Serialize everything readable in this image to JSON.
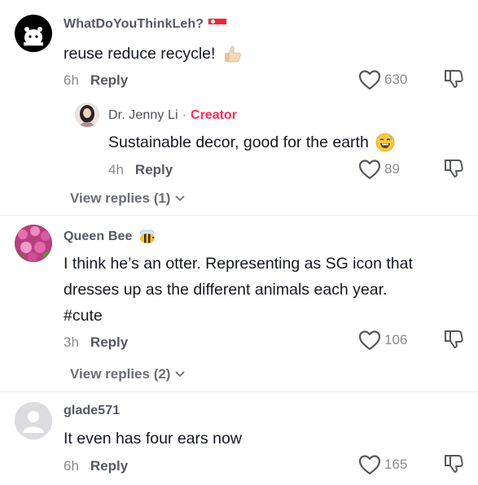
{
  "comments": [
    {
      "username": "WhatDoYouThinkLeh?",
      "text": "reuse reduce recycle!",
      "time": "6h",
      "reply_label": "Reply",
      "likes": "630"
    },
    {
      "username": "Dr. Jenny Li",
      "badge_sep": "·",
      "badge": "Creator",
      "text": "Sustainable decor, good for the earth",
      "time": "4h",
      "reply_label": "Reply",
      "likes": "89"
    },
    {
      "view_replies": "View replies (1)"
    },
    {
      "username": "Queen Bee",
      "text_lines": [
        "I think he’s an otter. Representing as SG icon that",
        "dresses up as the different animals each year.",
        "#cute"
      ],
      "time": "3h",
      "reply_label": "Reply",
      "likes": "106",
      "view_replies": "View replies (2)"
    },
    {
      "username": "glade571",
      "text": "It even has four ears now",
      "time": "6h",
      "reply_label": "Reply",
      "likes": "165"
    }
  ],
  "icons": {
    "like": "heart-outline-icon",
    "dislike": "thumbs-down-outline-icon",
    "chevron": "chevron-down-icon"
  },
  "colors": {
    "creator_badge": "#fe2c55",
    "flag_red": "#ee2536"
  }
}
